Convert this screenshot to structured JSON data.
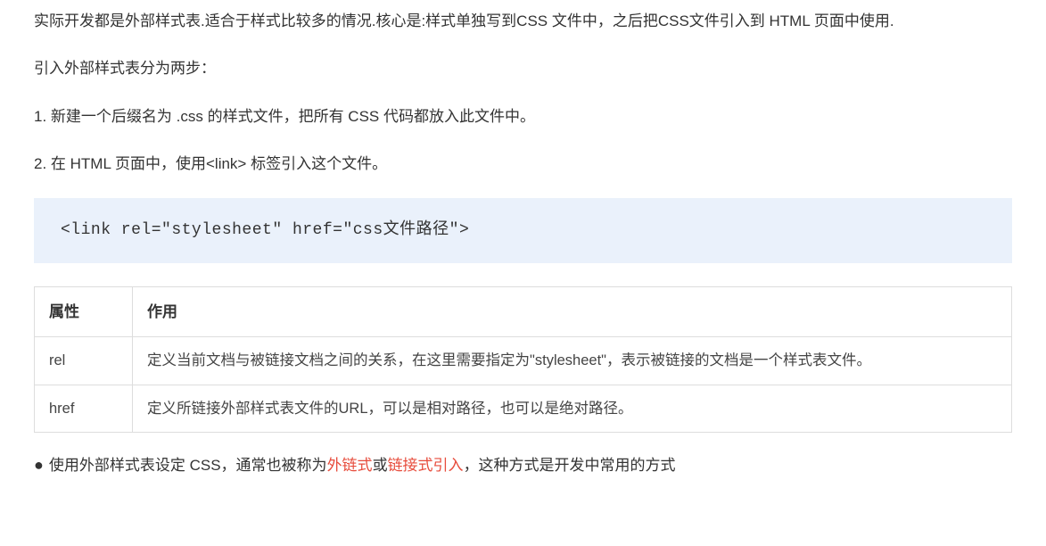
{
  "p1": "实际开发都是外部样式表.适合于样式比较多的情况.核心是:样式单独写到CSS 文件中，之后把CSS文件引入到 HTML 页面中使用.",
  "p2": "引入外部样式表分为两步：",
  "step1": "1. 新建一个后缀名为 .css 的样式文件，把所有 CSS 代码都放入此文件中。",
  "step2": "2. 在 HTML 页面中，使用<link> 标签引入这个文件。",
  "code": "<link rel=\"stylesheet\"  href=\"css文件路径\">",
  "table": {
    "headers": {
      "col1": "属性",
      "col2": "作用"
    },
    "rows": [
      {
        "attr": "rel",
        "desc": "定义当前文档与被链接文档之间的关系，在这里需要指定为\"stylesheet\"，表示被链接的文档是一个样式表文件。"
      },
      {
        "attr": "href",
        "desc": "定义所链接外部样式表文件的URL，可以是相对路径，也可以是绝对路径。"
      }
    ]
  },
  "bullet": {
    "part1": "使用外部样式表设定 CSS，通常也被称为",
    "red1": "外链式",
    "part2": "或",
    "red2": "链接式引入",
    "part3": "，这种方式是开发中常用的方式"
  }
}
